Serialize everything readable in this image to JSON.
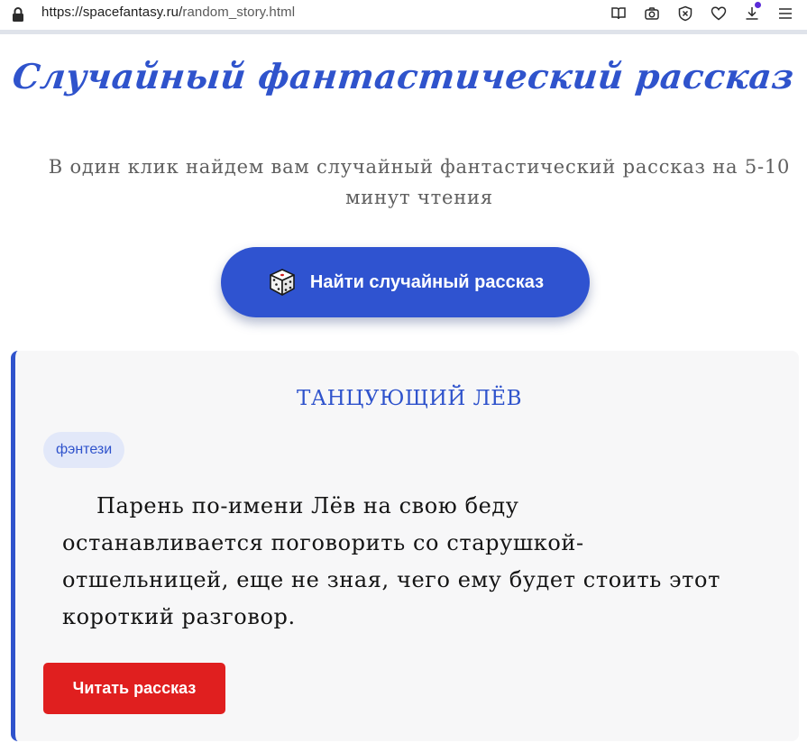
{
  "browser": {
    "url_domain": "https://spacefantasy.ru/",
    "url_path": "random_story.html",
    "icons": [
      "reader-view-icon",
      "screenshot-icon",
      "shield-icon",
      "heart-icon",
      "download-icon",
      "menu-icon"
    ],
    "accent_color": "#5b2bd9"
  },
  "header": {
    "title": "Случайный фантастический рассказ",
    "subtitle": "В один клик найдем вам случайный фантастический рассказ на 5-10 минут чтения"
  },
  "random_button": {
    "label": "Найти случайный рассказ",
    "icon": "dice-icon",
    "color": "#2f53d0"
  },
  "story": {
    "title": "ТАНЦУЮЩИЙ ЛЁВ",
    "genre": "фэнтези",
    "excerpt": "Парень по-имени Лёв на свою беду останавливается поговорить со старушкой-отшельницей, еще не зная, чего ему будет стоить этот короткий разговор.",
    "read_button": "Читать рассказ",
    "read_button_color": "#e01f1f"
  }
}
